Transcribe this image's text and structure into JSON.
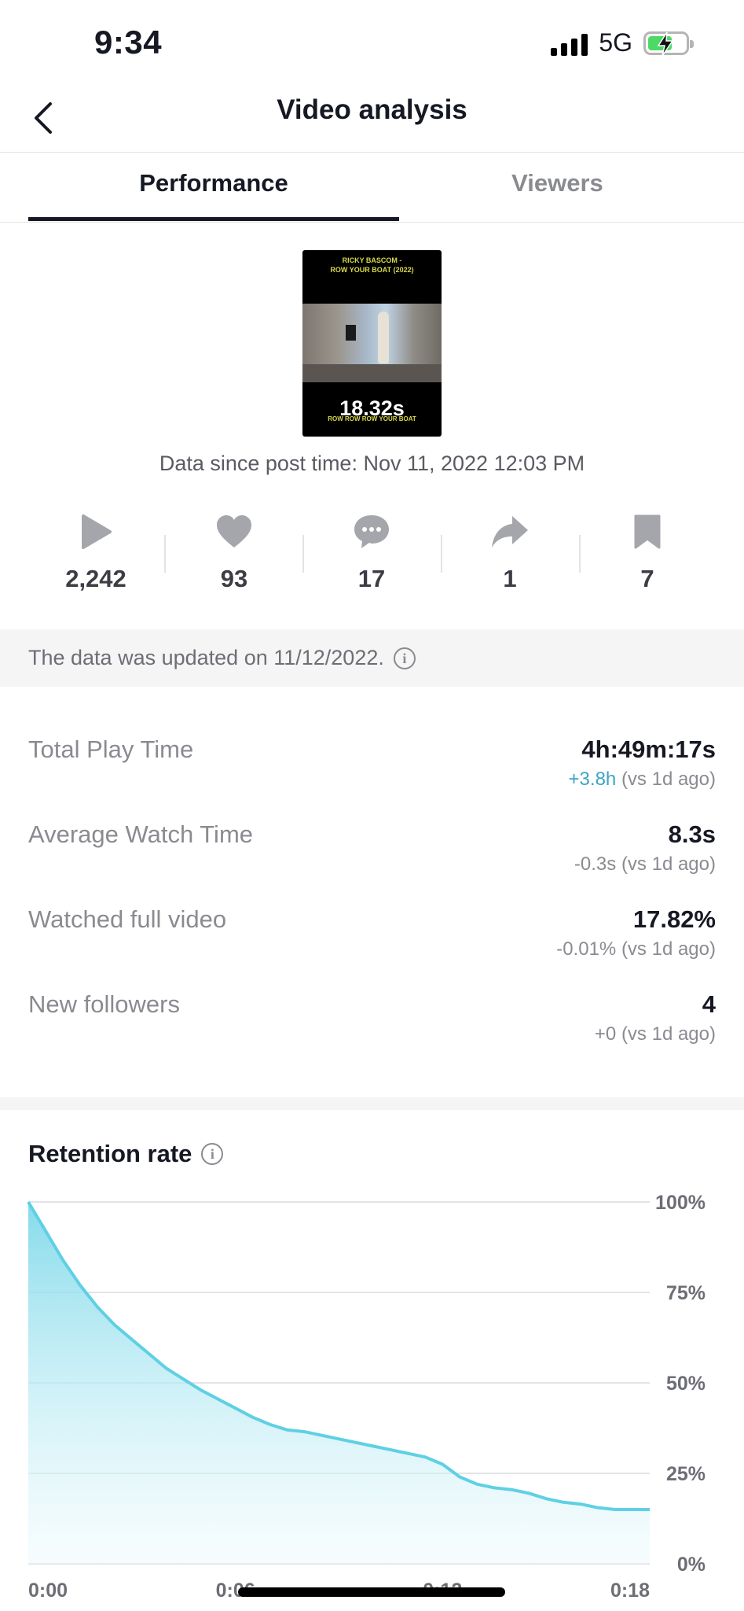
{
  "status_bar": {
    "time": "9:34",
    "network": "5G"
  },
  "nav": {
    "title": "Video analysis"
  },
  "tabs": [
    {
      "label": "Performance",
      "active": true
    },
    {
      "label": "Viewers",
      "active": false
    }
  ],
  "video": {
    "title_line1": "RICKY BASCOM -",
    "title_line2": "ROW YOUR BOAT (2022)",
    "duration": "18.32s",
    "caption": "ROW ROW ROW YOUR BOAT",
    "since": "Data since post time: Nov 11, 2022 12:03 PM"
  },
  "stats": [
    {
      "icon": "play-icon",
      "value": "2,242"
    },
    {
      "icon": "heart-icon",
      "value": "93"
    },
    {
      "icon": "comment-icon",
      "value": "17"
    },
    {
      "icon": "share-icon",
      "value": "1"
    },
    {
      "icon": "bookmark-icon",
      "value": "7"
    }
  ],
  "updated_text": "The data was updated on 11/12/2022.",
  "metrics": [
    {
      "label": "Total Play Time",
      "value": "4h:49m:17s",
      "delta": "+3.8h",
      "delta_positive": true,
      "compare": "(vs 1d ago)"
    },
    {
      "label": "Average Watch Time",
      "value": "8.3s",
      "delta": "-0.3s",
      "delta_positive": false,
      "compare": "(vs 1d ago)"
    },
    {
      "label": "Watched full video",
      "value": "17.82%",
      "delta": "-0.01%",
      "delta_positive": false,
      "compare": "(vs 1d ago)"
    },
    {
      "label": "New followers",
      "value": "4",
      "delta": "+0",
      "delta_positive": false,
      "compare": "(vs 1d ago)"
    }
  ],
  "retention": {
    "title": "Retention rate"
  },
  "chart_data": {
    "type": "area",
    "title": "Retention rate",
    "x_unit": "seconds",
    "xlim": [
      0,
      18
    ],
    "ylim": [
      0,
      100
    ],
    "x_ticks": [
      "0:00",
      "0:06",
      "0:12",
      "0:18"
    ],
    "y_ticks": [
      "100%",
      "75%",
      "50%",
      "25%",
      "0%"
    ],
    "grid": true,
    "color": "#5fd0e4",
    "x": [
      0,
      0.5,
      1,
      1.5,
      2,
      2.5,
      3,
      3.5,
      4,
      4.5,
      5,
      5.5,
      6,
      6.5,
      7,
      7.5,
      8,
      8.5,
      9,
      9.5,
      10,
      10.5,
      11,
      11.5,
      12,
      12.5,
      13,
      13.5,
      14,
      14.5,
      15,
      15.5,
      16,
      16.5,
      17,
      17.5,
      18
    ],
    "y": [
      100,
      92,
      84,
      77,
      71,
      66,
      62,
      58,
      54,
      51,
      48,
      45.5,
      43,
      40.5,
      38.5,
      37,
      36.5,
      35.5,
      34.5,
      33.5,
      32.5,
      31.5,
      30.5,
      29.5,
      27.5,
      24,
      22,
      21,
      20.5,
      19.5,
      18,
      17,
      16.5,
      15.5,
      15,
      15,
      15
    ]
  }
}
